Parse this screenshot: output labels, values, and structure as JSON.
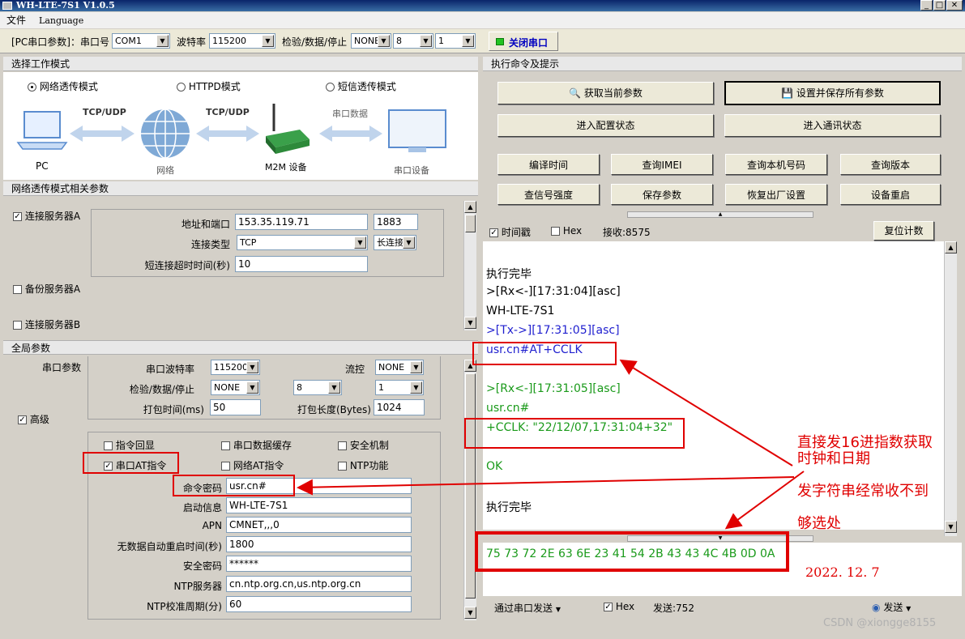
{
  "window": {
    "title": "WH-LTE-7S1 V1.0.5"
  },
  "menu": [
    "文件",
    "Language"
  ],
  "toolbar": {
    "serial_label": "[PC串口参数]：串口号",
    "port": "COM1",
    "baud_label": "波特率",
    "baud": "115200",
    "parity_label": "检验/数据/停止",
    "parity": "NONE",
    "databits": "8",
    "stopbits": "1",
    "close_label": "关闭串口",
    "status_color": "#22c322"
  },
  "mode_section": {
    "title": "选择工作模式",
    "modes": [
      "网络透传模式",
      "HTTPD模式",
      "短信透传模式"
    ],
    "selected": 0,
    "diagram": {
      "pc": "PC",
      "link1": "TCP/UDP",
      "net": "网络",
      "link2": "TCP/UDP",
      "device": "M2M 设备",
      "link3": "串口数据",
      "serial": "串口设备"
    }
  },
  "net_section": {
    "title": "网络透传模式相关参数",
    "serverA": "连接服务器A",
    "addr_label": "地址和端口",
    "addr": "153.35.119.71",
    "port": "1883",
    "conn_type_label": "连接类型",
    "conn_type": "TCP",
    "conn_mode": "长连接",
    "timeout_label": "短连接超时时间(秒)",
    "timeout": "10",
    "backup": "备份服务器A",
    "serverB": "连接服务器B"
  },
  "global_section": {
    "title": "全局参数",
    "serial_label": "串口参数",
    "baud_label": "串口波特率",
    "baud": "115200",
    "flow_label": "流控",
    "flow": "NONE",
    "parity_label": "检验/数据/停止",
    "parity": "NONE",
    "databits": "8",
    "stopbits": "1",
    "pack_time_label": "打包时间(ms)",
    "pack_time": "50",
    "pack_len_label": "打包长度(Bytes)",
    "pack_len": "1024",
    "advanced": "高级",
    "checks": [
      "指令回显",
      "串口数据缓存",
      "安全机制",
      "串口AT指令",
      "网络AT指令",
      "NTP功能"
    ],
    "cmd_pwd_label": "命令密码",
    "cmd_pwd": "usr.cn#",
    "boot_label": "启动信息",
    "boot": "WH-LTE-7S1",
    "apn_label": "APN",
    "apn": "CMNET,,,0",
    "restart_label": "无数据自动重启时间(秒)",
    "restart": "1800",
    "sec_pwd_label": "安全密码",
    "sec_pwd": "******",
    "ntp_label": "NTP服务器",
    "ntp": "cn.ntp.org.cn,us.ntp.org.cn",
    "ntp_period_label": "NTP校准周期(分)",
    "ntp_period": "60"
  },
  "cmd_section": {
    "title": "执行命令及提示",
    "buttons": [
      "获取当前参数",
      "设置并保存所有参数",
      "进入配置状态",
      "进入通讯状态",
      "编译时间",
      "查询IMEI",
      "查询本机号码",
      "查询版本",
      "查信号强度",
      "保存参数",
      "恢复出厂设置",
      "设备重启"
    ]
  },
  "log": {
    "timestamp_label": "时间戳",
    "hex_label": "Hex",
    "recv_label": "接收:8575",
    "reset_label": "复位计数",
    "lines": [
      "执行完毕",
      ">[Rx<-][17:31:04][asc]",
      "WH-LTE-7S1",
      ">[Tx->][17:31:05][asc]",
      "usr.cn#AT+CCLK",
      ">[Rx<-][17:31:05][asc]",
      "usr.cn#",
      "+CCLK: \"22/12/07,17:31:04+32\"",
      "OK",
      "执行完毕"
    ],
    "colors": {
      "black": "#000000",
      "blue": "#1f1fcf",
      "green": "#1a9a1a"
    }
  },
  "send": {
    "hex_text": "75 73 72 2E 63 6E 23 41 54 2B 43 43 4C 4B 0D 0A",
    "via_label": "通过串口发送",
    "hex_label": "Hex",
    "sent_label": "发送:752",
    "send_label": "发送"
  },
  "annotations": {
    "note1": "直接发16进指数获取",
    "note2": "时钟和日期",
    "note3": "发字符串经常收不到",
    "note4": "够选处",
    "date": "2022. 12. 7",
    "watermark": "CSDN @xiongge8155"
  }
}
